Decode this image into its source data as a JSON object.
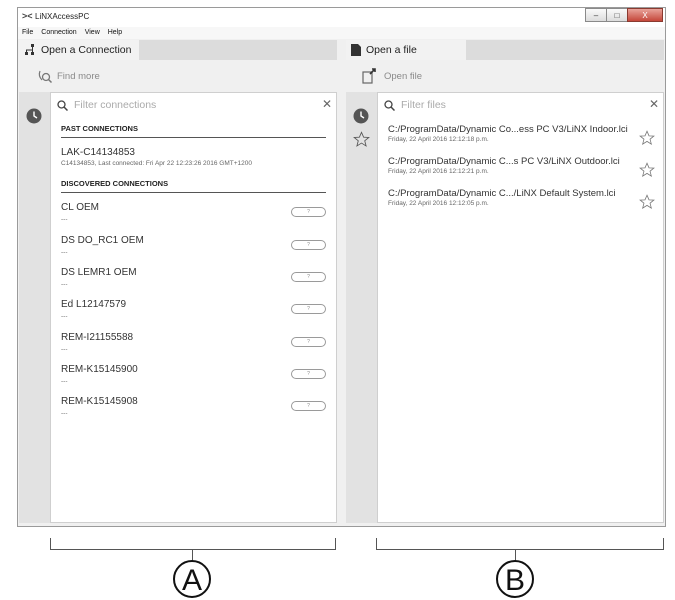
{
  "window": {
    "title": "LiNXAccessPC",
    "logo": "><"
  },
  "window_controls": {
    "minimize": "–",
    "maximize": "□",
    "close": "X"
  },
  "menu": [
    "File",
    "Connection",
    "View",
    "Help"
  ],
  "connection_pane": {
    "tab_label": "Open a Connection",
    "tab_icon": "tree-connection-icon",
    "tool_label": "Find more",
    "search_placeholder": "Filter connections",
    "past_header": "PAST CONNECTIONS",
    "past": [
      {
        "name": "LAK-C14134853",
        "detail": "C14134853, Last connected: Fri Apr 22 12:23:26 2016 GMT+1200"
      }
    ],
    "discovered_header": "DISCOVERED CONNECTIONS",
    "discovered": [
      {
        "name": "CL OEM",
        "detail": "---"
      },
      {
        "name": "DS DO_RC1 OEM",
        "detail": "---"
      },
      {
        "name": "DS LEMR1 OEM",
        "detail": "---"
      },
      {
        "name": "Ed L12147579",
        "detail": "---"
      },
      {
        "name": "REM-I21155588",
        "detail": "---"
      },
      {
        "name": "REM-K15145900",
        "detail": "---"
      },
      {
        "name": "REM-K15145908",
        "detail": "---"
      }
    ]
  },
  "file_pane": {
    "tab_label": "Open a file",
    "tab_icon": "document-icon",
    "tool_label": "Open file",
    "search_placeholder": "Filter files",
    "files": [
      {
        "path": "C:/ProgramData/Dynamic Co...ess PC V3/LiNX Indoor.lci",
        "date": "Friday, 22 April 2016 12:12:18 p.m."
      },
      {
        "path": "C:/ProgramData/Dynamic C...s PC V3/LiNX Outdoor.lci",
        "date": "Friday, 22 April 2016 12:12:21 p.m."
      },
      {
        "path": "C:/ProgramData/Dynamic C.../LiNX Default System.lci",
        "date": "Friday, 22 April 2016 12:12:05 p.m."
      }
    ]
  },
  "callouts": {
    "a": "A",
    "b": "B"
  },
  "colors": {
    "rail": "#e2e2e2",
    "tabstrip": "#dcdcdc",
    "text": "#333333",
    "muted": "#8a8a8a"
  }
}
